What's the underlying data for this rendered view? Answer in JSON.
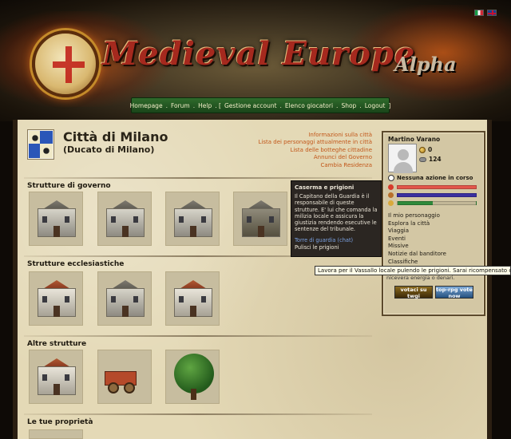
{
  "header": {
    "logo_title": "Medieval Europe",
    "logo_badge": "Alpha"
  },
  "nav": {
    "items": [
      "Homepage",
      "Forum",
      "Help",
      "Gestione account",
      "Elenco giocatori",
      "Shop",
      "Logout"
    ]
  },
  "city": {
    "name": "Città di Milano",
    "duchy": "(Ducato di Milano)",
    "links": [
      "Informazioni sulla città",
      "Lista dei personaggi attualmente in città",
      "Lista delle botteghe cittadine",
      "Annunci del Governo",
      "Cambia Residenza"
    ]
  },
  "sections": [
    "Strutture di governo",
    "Strutture ecclesiastiche",
    "Altre strutture",
    "Le tue proprietà"
  ],
  "tooltip": {
    "title": "Caserma e prigioni",
    "body": "Il Capitano della Guardia è il responsabile di queste strutture. E' lui che comanda la milizia locale e assicura la giustizia rendendo esecutive le sentenze del tribunale.",
    "link": "Torre di guardia (chat)",
    "action": "Pulisci le prigioni"
  },
  "hint": {
    "text": "Lavora per il Vassallo locale pulendo le prigioni. Sarai ricompensato con una",
    "continuation": "nicevera energia o denari."
  },
  "sidebar": {
    "player_name": "Martino Varano",
    "coins": "0",
    "items": "124",
    "action_status": "Nessuna azione in corso",
    "bars": [
      {
        "color": "#e2564a",
        "icon": "heart-icon",
        "value": 1.0
      },
      {
        "color": "#3a2fa0",
        "icon": "energy-icon",
        "value": 1.0
      },
      {
        "color": "#2f8a3a",
        "icon": "food-icon",
        "value": 0.45
      }
    ],
    "menu": [
      "Il mio personaggio",
      "Esplora la città",
      "Viaggia",
      "Eventi",
      "Missive",
      "Notizie dal banditore",
      "Classifiche"
    ],
    "vote_buttons": [
      "votaci su twgi",
      "top-rpg vote now"
    ]
  }
}
